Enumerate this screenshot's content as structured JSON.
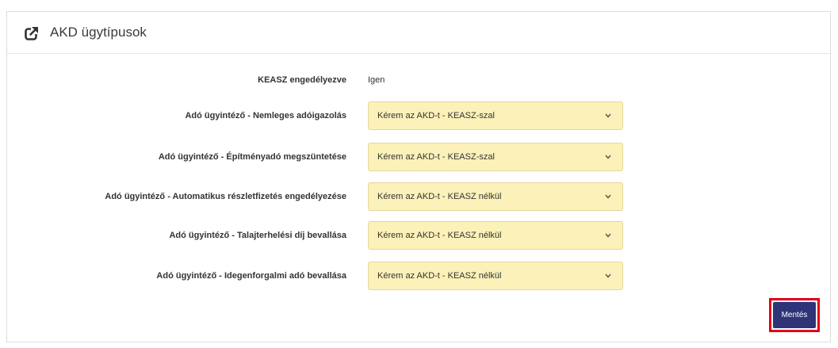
{
  "panel": {
    "title": "AKD ügytípusok",
    "icon": "external-link-icon"
  },
  "keasz": {
    "label": "KEASZ engedélyezve",
    "value": "Igen"
  },
  "rows": [
    {
      "label": "Adó ügyintéző - Nemleges adóigazolás",
      "selected": "Kérem az AKD-t - KEASZ-szal"
    },
    {
      "label": "Adó ügyintéző - Építményadó megszüntetése",
      "selected": "Kérem az AKD-t - KEASZ-szal"
    },
    {
      "label": "Adó ügyintéző - Automatikus részletfizetés engedélyezése",
      "selected": "Kérem az AKD-t - KEASZ nélkül"
    },
    {
      "label": "Adó ügyintéző - Talajterhelési díj bevallása",
      "selected": "Kérem az AKD-t - KEASZ nélkül"
    },
    {
      "label": "Adó ügyintéző - Idegenforgalmi adó bevallása",
      "selected": "Kérem az AKD-t - KEASZ nélkül"
    }
  ],
  "save_label": "Mentés",
  "colors": {
    "select_bg": "#fbf1b9",
    "button_bg": "#2f3378",
    "highlight": "#e3001b"
  }
}
